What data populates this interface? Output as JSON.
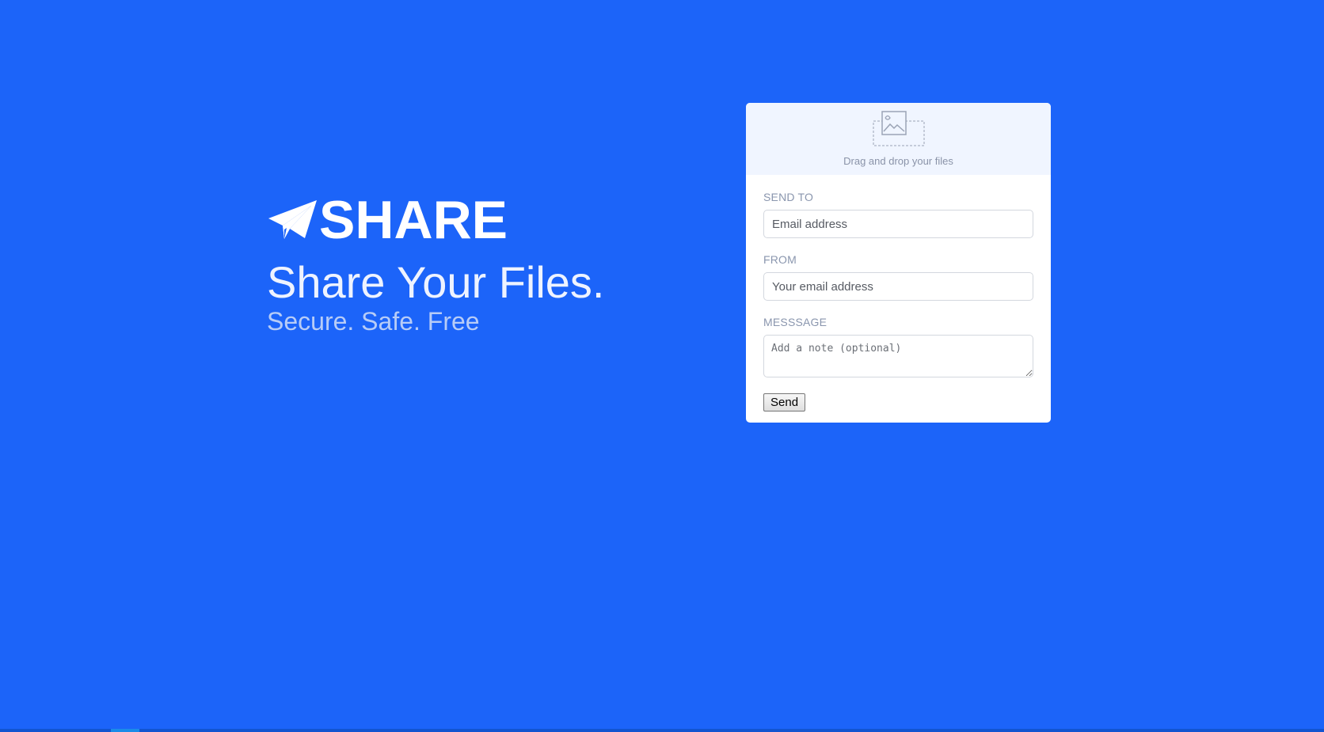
{
  "brand": {
    "logo_text": "SHARE",
    "icon": "paper-plane-icon"
  },
  "hero": {
    "headline": "Share Your Files.",
    "tagline": "Secure. Safe. Free"
  },
  "dropzone": {
    "icon": "image-placeholder-icon",
    "text": "Drag and drop your files"
  },
  "form": {
    "send_to": {
      "label": "SEND TO",
      "placeholder": "Email address",
      "value": ""
    },
    "from": {
      "label": "FROM",
      "placeholder": "Your email address",
      "value": ""
    },
    "message": {
      "label": "MESSSAGE",
      "placeholder": "Add a note (optional)",
      "value": ""
    },
    "submit_label": "Send"
  },
  "colors": {
    "background": "#1c64f9",
    "card": "#ffffff",
    "dropzone": "#f0f5ff",
    "label": "#8a96ae"
  }
}
